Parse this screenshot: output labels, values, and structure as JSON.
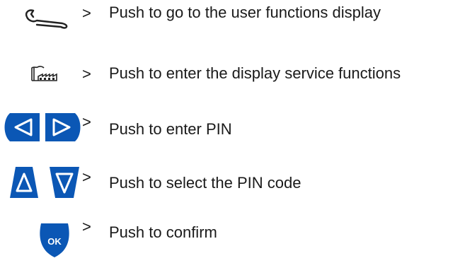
{
  "accent_color": "#0b57b5",
  "instructions": [
    {
      "icon": "wrench-icon",
      "arrow": ">",
      "text": "Push to go to the user functions display"
    },
    {
      "icon": "factory-icon",
      "arrow": ">",
      "text": "Push to enter the display service functions"
    },
    {
      "icon": "left-right-arrows-icon",
      "arrow": ">",
      "text": "Push to enter PIN"
    },
    {
      "icon": "up-down-arrows-icon",
      "arrow": ">",
      "text": "Push to select the PIN code"
    },
    {
      "icon": "ok-button-icon",
      "ok_label": "OK",
      "arrow": ">",
      "text": "Push to confirm"
    }
  ]
}
